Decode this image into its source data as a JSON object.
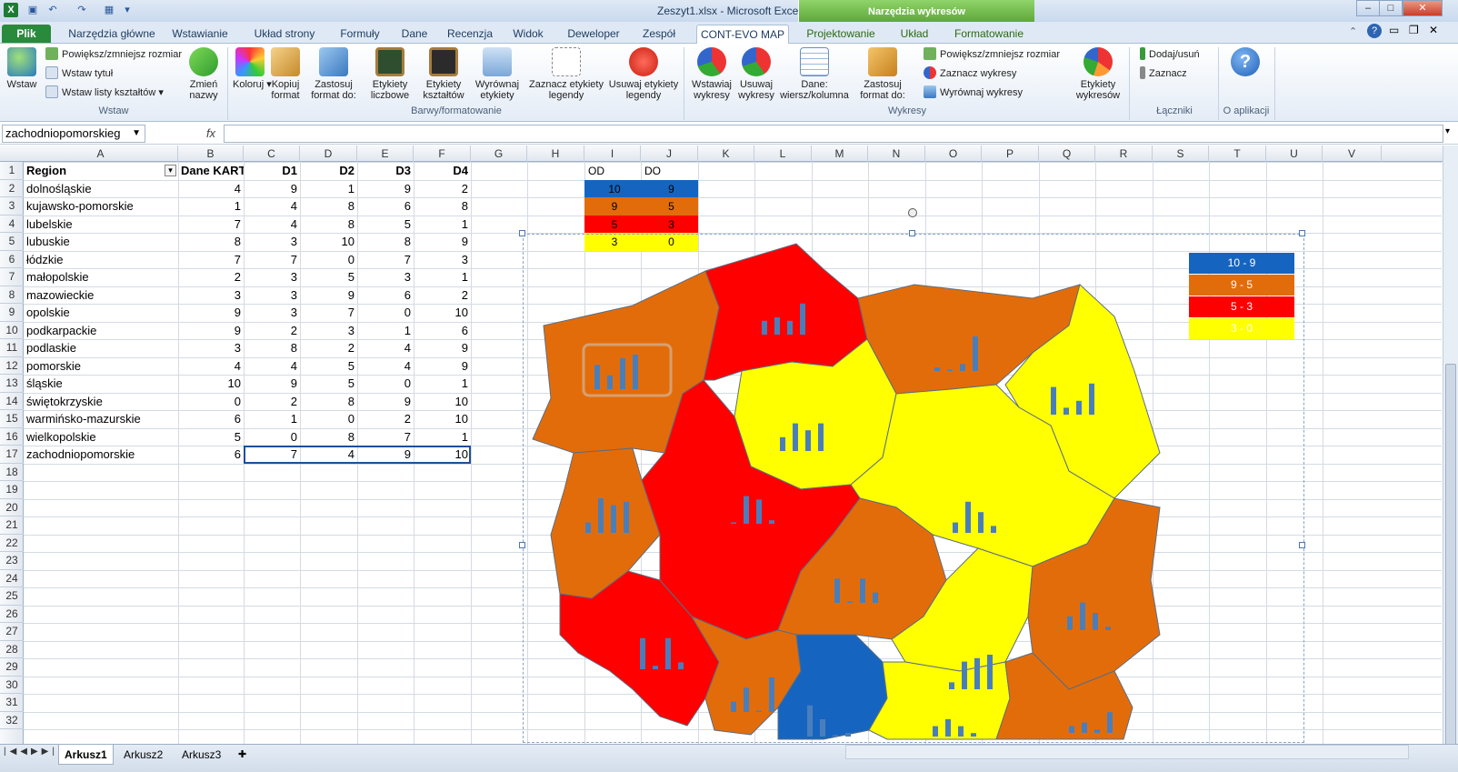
{
  "window": {
    "title": "Zeszyt1.xlsx - Microsoft Excel",
    "context_group": "Narzędzia wykresów"
  },
  "tabs": [
    "Plik",
    "Narzędzia główne",
    "Wstawianie",
    "Układ strony",
    "Formuły",
    "Dane",
    "Recenzja",
    "Widok",
    "Deweloper",
    "Zespół",
    "CONT-EVO MAP",
    "Projektowanie",
    "Układ",
    "Formatowanie"
  ],
  "ribbon": {
    "wstaw_big": "Wstaw",
    "powieksz": "Powiększ/zmniejsz rozmiar",
    "wstaw_tytul": "Wstaw tytuł",
    "wstaw_listy": "Wstaw listy kształtów",
    "zmien_nazwy": "Zmień nazwy",
    "group_wstaw": "Wstaw",
    "koloruj": "Koloruj",
    "kopiuj_format": "Kopiuj format",
    "zastosuj_format": "Zastosuj format do:",
    "etykiety_liczbowe": "Etykiety liczbowe",
    "etykiety_ksztaltow": "Etykiety kształtów",
    "wyrownaj_etykiety": "Wyrównaj etykiety",
    "zaznacz_etykiety": "Zaznacz etykiety legendy",
    "usuwaj_etykiety": "Usuwaj etykiety legendy",
    "group_barwy": "Barwy/formatowanie",
    "wstawiaj_wykresy": "Wstawiaj wykresy",
    "usuwaj_wykresy": "Usuwaj wykresy",
    "dane_wiersz": "Dane: wiersz/kolumna",
    "zastosuj_format2": "Zastosuj format do:",
    "powieksz2": "Powiększ/zmniejsz rozmiar",
    "zaznacz_wykresy": "Zaznacz wykresy",
    "wyrownaj_wykresy": "Wyrównaj wykresy",
    "etykiety_wykresow": "Etykiety wykresów",
    "group_wykresy": "Wykresy",
    "dodaj_usun": "Dodaj/usuń",
    "zaznacz": "Zaznacz",
    "group_laczniki": "Łączniki",
    "group_oaplikacji": "O aplikacji"
  },
  "formula_bar": {
    "name_box": "zachodniopomorskieg",
    "fx": "fx",
    "value": ""
  },
  "columns": [
    "A",
    "B",
    "C",
    "D",
    "E",
    "F",
    "G",
    "H",
    "I",
    "J",
    "K",
    "L",
    "M",
    "N",
    "O",
    "P",
    "Q",
    "R",
    "S",
    "T",
    "U",
    "V"
  ],
  "rows": [
    "1",
    "2",
    "3",
    "4",
    "5",
    "6",
    "7",
    "8",
    "9",
    "10",
    "11",
    "12",
    "13",
    "14",
    "15",
    "16",
    "17",
    "18",
    "19",
    "20",
    "21",
    "22",
    "23",
    "24",
    "25",
    "26",
    "27",
    "28",
    "29",
    "30",
    "31",
    "32"
  ],
  "table": {
    "headers": [
      "Region",
      "Dane KART",
      "D1",
      "D2",
      "D3",
      "D4"
    ],
    "rows": [
      [
        "dolnośląskie",
        "4",
        "9",
        "1",
        "9",
        "2"
      ],
      [
        "kujawsko-pomorskie",
        "1",
        "4",
        "8",
        "6",
        "8"
      ],
      [
        "lubelskie",
        "7",
        "4",
        "8",
        "5",
        "1"
      ],
      [
        "lubuskie",
        "8",
        "3",
        "10",
        "8",
        "9"
      ],
      [
        "łódzkie",
        "7",
        "7",
        "0",
        "7",
        "3"
      ],
      [
        "małopolskie",
        "2",
        "3",
        "5",
        "3",
        "1"
      ],
      [
        "mazowieckie",
        "3",
        "3",
        "9",
        "6",
        "2"
      ],
      [
        "opolskie",
        "9",
        "3",
        "7",
        "0",
        "10"
      ],
      [
        "podkarpackie",
        "9",
        "2",
        "3",
        "1",
        "6"
      ],
      [
        "podlaskie",
        "3",
        "8",
        "2",
        "4",
        "9"
      ],
      [
        "pomorskie",
        "4",
        "4",
        "5",
        "4",
        "9"
      ],
      [
        "śląskie",
        "10",
        "9",
        "5",
        "0",
        "1"
      ],
      [
        "świętokrzyskie",
        "0",
        "2",
        "8",
        "9",
        "10"
      ],
      [
        "warmińsko-mazurskie",
        "6",
        "1",
        "0",
        "2",
        "10"
      ],
      [
        "wielkopolskie",
        "5",
        "0",
        "8",
        "7",
        "1"
      ],
      [
        "zachodniopomorskie",
        "6",
        "7",
        "4",
        "9",
        "10"
      ]
    ]
  },
  "range_table": {
    "headers": [
      "OD",
      "DO"
    ],
    "rows": [
      [
        "10",
        "9"
      ],
      [
        "9",
        "5"
      ],
      [
        "5",
        "3"
      ],
      [
        "3",
        "0"
      ]
    ]
  },
  "map_legend": [
    "10 - 9",
    "9 - 5",
    "5 - 3",
    "3 - 0"
  ],
  "colors": {
    "blue": "#1565c0",
    "orange": "#e36c0a",
    "red": "#ff0000",
    "yellow": "#ffff00",
    "bar": "#4a7ebb"
  },
  "sheets": [
    "Arkusz1",
    "Arkusz2",
    "Arkusz3"
  ]
}
